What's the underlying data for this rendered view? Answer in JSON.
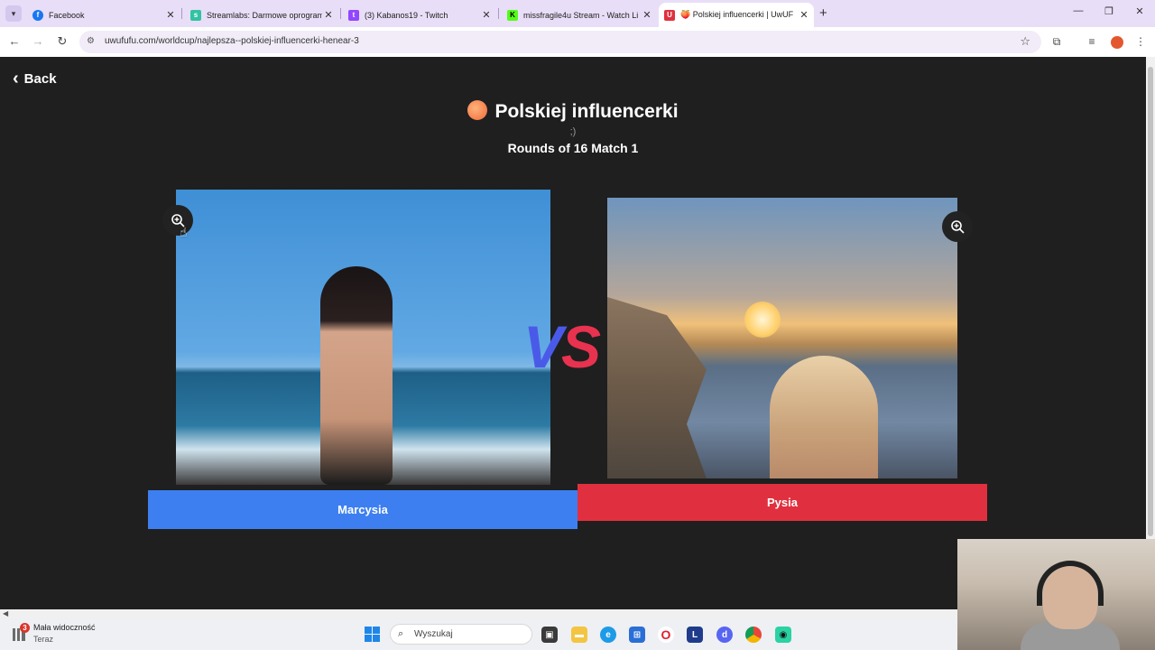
{
  "browser": {
    "tabs": [
      {
        "title": "Facebook",
        "favicon_color": "#1877f2",
        "favicon_glyph": "f"
      },
      {
        "title": "Streamlabs: Darmowe oprogram",
        "favicon_color": "#31c3a2",
        "favicon_glyph": "s"
      },
      {
        "title": "(3) Kabanos19 - Twitch",
        "favicon_color": "#9146ff",
        "favicon_glyph": "t"
      },
      {
        "title": "missfragile4u Stream - Watch Li",
        "favicon_color": "#53fc18",
        "favicon_glyph": "K"
      },
      {
        "title": "🍑 Polskiej influencerki | UwUF",
        "favicon_color": "#e0303f",
        "favicon_glyph": "U"
      }
    ],
    "url": "uwufufu.com/worldcup/najlepsza--polskiej-influencerki-henear-3"
  },
  "page": {
    "back_label": "Back",
    "title": "Polskiej influencerki",
    "subtitle": ";)",
    "round_text": "Rounds of 16 Match 1",
    "vs_v": "V",
    "vs_s": "S",
    "left_choice": "Marcysia",
    "right_choice": "Pysia"
  },
  "taskbar": {
    "notification_count": "3",
    "notification_title": "Mała widoczność",
    "notification_sub": "Teraz",
    "search_placeholder": "Wyszukaj"
  },
  "colors": {
    "left_button": "#3d7ff0",
    "right_button": "#e0303f",
    "vs_v": "#4a5ae8",
    "vs_s": "#e8324f",
    "page_bg": "#1f1f1f"
  }
}
